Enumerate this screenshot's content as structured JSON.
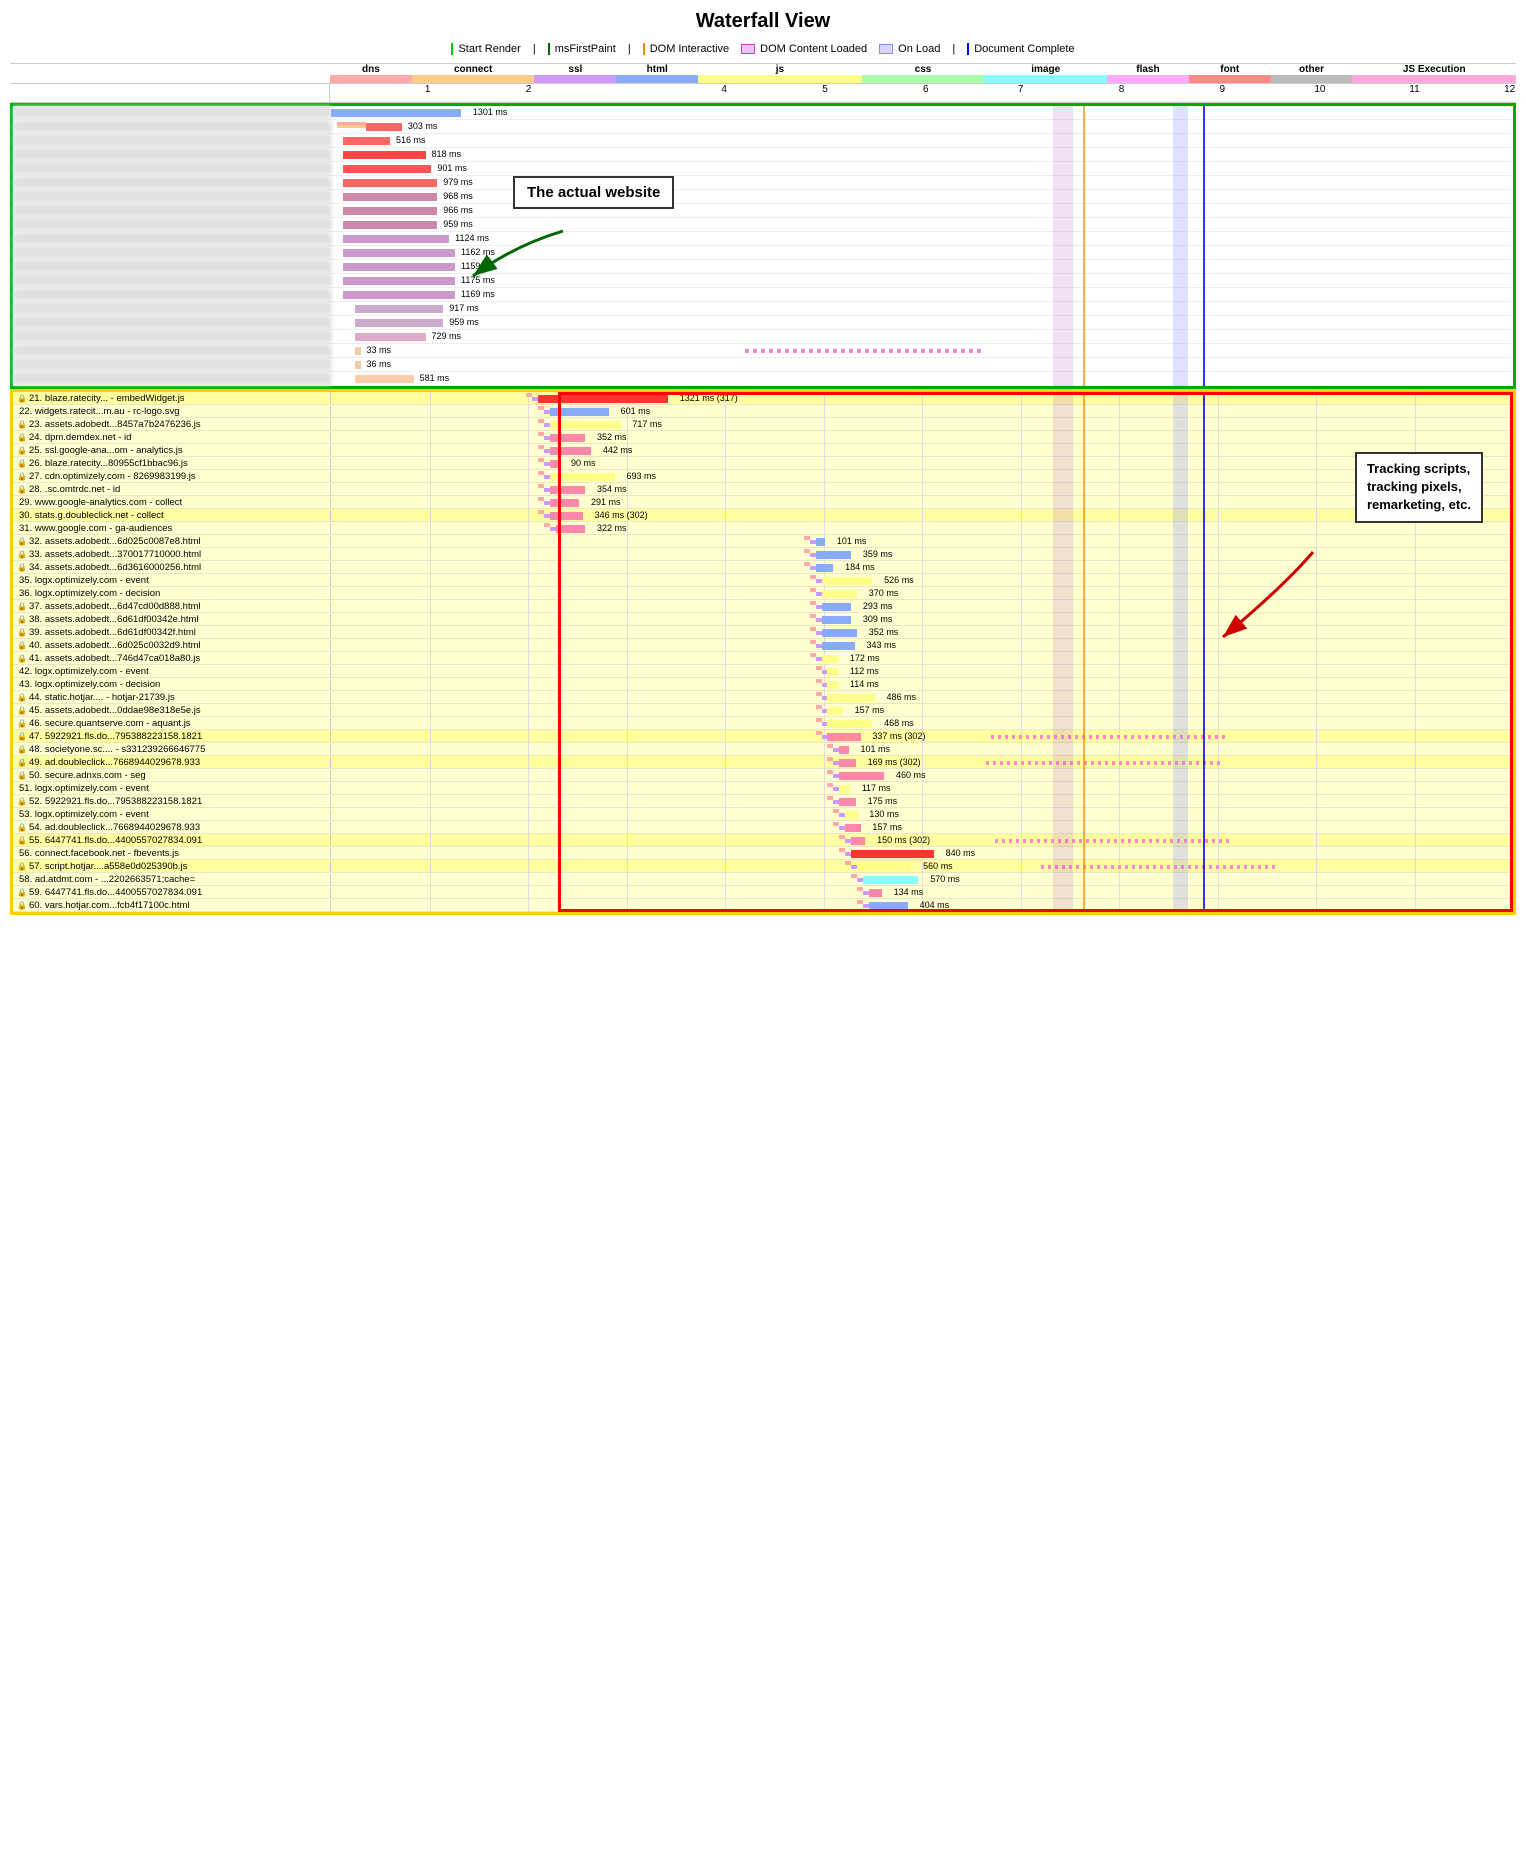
{
  "title": "Waterfall View",
  "legend": {
    "items": [
      {
        "label": "Start Render",
        "color": "#00cc00",
        "type": "line"
      },
      {
        "label": "msFirstPaint",
        "color": "#008800",
        "type": "line"
      },
      {
        "label": "DOM Interactive",
        "color": "#ff8800",
        "type": "line"
      },
      {
        "label": "DOM Content Loaded",
        "color": "#cc44cc",
        "type": "fill"
      },
      {
        "label": "On Load",
        "color": "#8888ff",
        "type": "fill"
      },
      {
        "label": "Document Complete",
        "color": "#0000ff",
        "type": "line"
      }
    ]
  },
  "types": [
    {
      "label": "dns",
      "color": "#ffaaaa"
    },
    {
      "label": "connect",
      "color": "#ffcc88"
    },
    {
      "label": "ssl",
      "color": "#cc99ff"
    },
    {
      "label": "html",
      "color": "#88aaff"
    },
    {
      "label": "js",
      "color": "#ffff88"
    },
    {
      "label": "css",
      "color": "#aaffaa"
    },
    {
      "label": "image",
      "color": "#88ffff"
    },
    {
      "label": "flash",
      "color": "#ffaaff"
    },
    {
      "label": "font",
      "color": "#ff8888"
    },
    {
      "label": "other",
      "color": "#bbbbbb"
    },
    {
      "label": "JS Execution",
      "color": "#ffaadd"
    }
  ],
  "annotations": {
    "actual_website": "The actual website",
    "tracking": "Tracking scripts,\ntracking pixels,\nremarketing, etc."
  },
  "scale_labels": [
    "1",
    "2",
    "4",
    "5",
    "6",
    "7",
    "8",
    "9",
    "10",
    "11",
    "12"
  ],
  "top_rows": [
    {
      "ms": "1301 ms",
      "color": "#88aaff"
    },
    {
      "ms": "303 ms",
      "color": "#ffaaaa"
    },
    {
      "ms": "516 ms",
      "color": "#ff6666"
    },
    {
      "ms": "818 ms",
      "color": "#ff4444"
    },
    {
      "ms": "901 ms",
      "color": "#ff5555"
    },
    {
      "ms": "979 ms",
      "color": "#ff6666"
    },
    {
      "ms": "968 ms",
      "color": "#cc88aa"
    },
    {
      "ms": "966 ms",
      "color": "#cc88aa"
    },
    {
      "ms": "959 ms",
      "color": "#cc88aa"
    },
    {
      "ms": "1124 ms",
      "color": "#cc99cc"
    },
    {
      "ms": "1162 ms",
      "color": "#cc99cc"
    },
    {
      "ms": "1159 ms",
      "color": "#cc99cc"
    },
    {
      "ms": "1175 ms",
      "color": "#cc99cc"
    },
    {
      "ms": "1169 ms",
      "color": "#cc99cc"
    },
    {
      "ms": "917 ms",
      "color": "#ccaacc"
    },
    {
      "ms": "959 ms",
      "color": "#ccaacc"
    },
    {
      "ms": "729 ms",
      "color": "#ddaacc"
    },
    {
      "ms": "33 ms",
      "color": "#eeccaa"
    },
    {
      "ms": "36 ms",
      "color": "#eeccaa"
    },
    {
      "ms": "581 ms",
      "color": "#ffccaa"
    }
  ],
  "bottom_rows": [
    {
      "num": "21",
      "url": "blaze.ratecity... - embedWidget.js",
      "ms": "1321 ms (317)",
      "yellow": true,
      "lock": true
    },
    {
      "num": "22",
      "url": "widgets.ratecit...m.au - rc-logo.svg",
      "ms": "601 ms",
      "yellow": false,
      "lock": false
    },
    {
      "num": "23",
      "url": "assets.adobedt...8457a7b2476236.js",
      "ms": "717 ms",
      "yellow": false,
      "lock": true
    },
    {
      "num": "24",
      "url": "dpm.demdex.net - id",
      "ms": "352 ms",
      "yellow": false,
      "lock": true
    },
    {
      "num": "25",
      "url": "ssl.google-ana...om - analytics.js",
      "ms": "442 ms",
      "yellow": false,
      "lock": true
    },
    {
      "num": "26",
      "url": "blaze.ratecity...80955cf1bbac96.js",
      "ms": "90 ms",
      "yellow": false,
      "lock": true
    },
    {
      "num": "27",
      "url": "cdn.optimizely.com - 8269983199.js",
      "ms": "693 ms",
      "yellow": false,
      "lock": true
    },
    {
      "num": "28",
      "url": ".sc.omtrdc.net - id",
      "ms": "354 ms",
      "yellow": false,
      "lock": true
    },
    {
      "num": "29",
      "url": "www.google-analytics.com - collect",
      "ms": "291 ms",
      "yellow": false,
      "lock": false
    },
    {
      "num": "30",
      "url": "stats.g.doubleclick.net - collect",
      "ms": "346 ms (302)",
      "yellow": true,
      "lock": false
    },
    {
      "num": "31",
      "url": "www.google.com - ga-audiences",
      "ms": "322 ms",
      "yellow": false,
      "lock": false
    },
    {
      "num": "32",
      "url": "assets.adobedt...6d025c0087e8.html",
      "ms": "101 ms",
      "yellow": false,
      "lock": true
    },
    {
      "num": "33",
      "url": "assets.adobedt...370017710000.html",
      "ms": "359 ms",
      "yellow": false,
      "lock": true
    },
    {
      "num": "34",
      "url": "assets.adobedt...6d3616000256.html",
      "ms": "184 ms",
      "yellow": false,
      "lock": true
    },
    {
      "num": "35",
      "url": "logx.optimizely.com - event",
      "ms": "526 ms",
      "yellow": false,
      "lock": false
    },
    {
      "num": "36",
      "url": "logx.optimizely.com - decision",
      "ms": "370 ms",
      "yellow": false,
      "lock": false
    },
    {
      "num": "37",
      "url": "assets.adobedt...6d47cd00d888.html",
      "ms": "293 ms",
      "yellow": false,
      "lock": true
    },
    {
      "num": "38",
      "url": "assets.adobedt...6d61df00342e.html",
      "ms": "309 ms",
      "yellow": false,
      "lock": true
    },
    {
      "num": "39",
      "url": "assets.adobedt...6d61df00342f.html",
      "ms": "352 ms",
      "yellow": false,
      "lock": true
    },
    {
      "num": "40",
      "url": "assets.adobedt...6d025c0032d9.html",
      "ms": "343 ms",
      "yellow": false,
      "lock": true
    },
    {
      "num": "41",
      "url": "assets.adobedt...746d47ca018a80.js",
      "ms": "172 ms",
      "yellow": false,
      "lock": true
    },
    {
      "num": "42",
      "url": "logx.optimizely.com - event",
      "ms": "112 ms",
      "yellow": false,
      "lock": false
    },
    {
      "num": "43",
      "url": "logx.optimizely.com - decision",
      "ms": "114 ms",
      "yellow": false,
      "lock": false
    },
    {
      "num": "44",
      "url": "static.hotjar.... - hotjar-21739.js",
      "ms": "486 ms",
      "yellow": false,
      "lock": true
    },
    {
      "num": "45",
      "url": "assets.adobedt...0ddae98e318e5e.js",
      "ms": "157 ms",
      "yellow": false,
      "lock": true
    },
    {
      "num": "46",
      "url": "secure.quantserve.com - aquant.js",
      "ms": "468 ms",
      "yellow": false,
      "lock": true
    },
    {
      "num": "47",
      "url": "5922921.fls.do...795388223158.1821",
      "ms": "337 ms (302)",
      "yellow": true,
      "lock": true
    },
    {
      "num": "48",
      "url": "societyone.sc.... - s331239266646775",
      "ms": "101 ms",
      "yellow": false,
      "lock": true
    },
    {
      "num": "49",
      "url": "ad.doubleclick...7668944029678.933",
      "ms": "169 ms (302)",
      "yellow": true,
      "lock": true
    },
    {
      "num": "50",
      "url": "secure.adnxs.com - seg",
      "ms": "460 ms",
      "yellow": false,
      "lock": true
    },
    {
      "num": "51",
      "url": "logx.optimizely.com - event",
      "ms": "117 ms",
      "yellow": false,
      "lock": false
    },
    {
      "num": "52",
      "url": "5922921.fls.do...795388223158.1821",
      "ms": "175 ms",
      "yellow": false,
      "lock": true
    },
    {
      "num": "53",
      "url": "logx.optimizely.com - event",
      "ms": "130 ms",
      "yellow": false,
      "lock": false
    },
    {
      "num": "54",
      "url": "ad.doubleclick...7668944029678.933",
      "ms": "157 ms",
      "yellow": false,
      "lock": true
    },
    {
      "num": "55",
      "url": "6447741.fls.do...4400557027834.091",
      "ms": "150 ms (302)",
      "yellow": true,
      "lock": true
    },
    {
      "num": "56",
      "url": "connect.facebook.net - fbevents.js",
      "ms": "840 ms",
      "yellow": false,
      "lock": false
    },
    {
      "num": "57",
      "url": "script.hotjar....a558e0d025390b.js",
      "ms": "560 ms",
      "yellow": true,
      "lock": true
    },
    {
      "num": "58",
      "url": "ad.atdmt.com - ...2202663571;cache=",
      "ms": "570 ms",
      "yellow": false,
      "lock": false
    },
    {
      "num": "59",
      "url": "6447741.fls.do...4400557027834.091",
      "ms": "134 ms",
      "yellow": false,
      "lock": true
    },
    {
      "num": "60",
      "url": "vars.hotjar.com...fcb4f17100c.html",
      "ms": "404 ms",
      "yellow": false,
      "lock": true
    }
  ]
}
